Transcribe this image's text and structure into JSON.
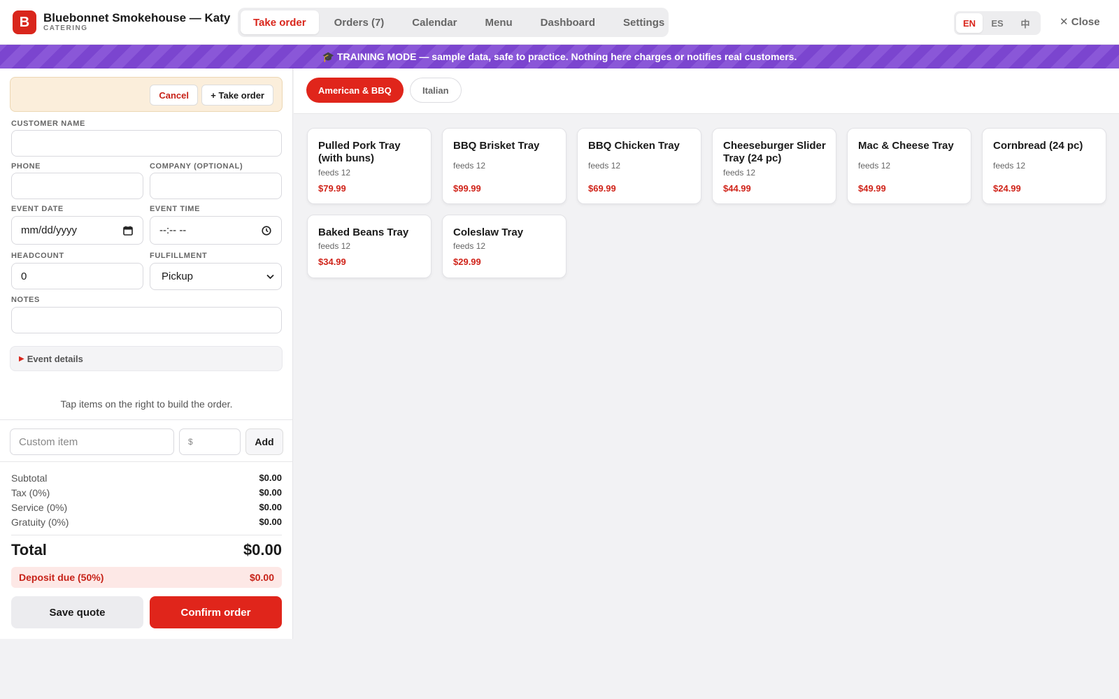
{
  "header": {
    "logo_letter": "B",
    "brand_name": "Bluebonnet Smokehouse — Katy",
    "brand_sub": "CATERING",
    "tabs": [
      {
        "label": "Take order"
      },
      {
        "label": "Orders (7)"
      },
      {
        "label": "Calendar"
      },
      {
        "label": "Menu"
      },
      {
        "label": "Dashboard"
      },
      {
        "label": "Settings"
      }
    ],
    "active_tab": "Take order",
    "languages": [
      "EN",
      "ES",
      "中"
    ],
    "active_language": "EN",
    "close_label": "✕ Close"
  },
  "banner": {
    "text": "🎓 TRAINING MODE — sample data, safe to practice. Nothing here charges or notifies real customers."
  },
  "order_form": {
    "cancel_label": "Cancel",
    "take_order_label": "+ Take order",
    "fields": {
      "customer_name": {
        "label": "CUSTOMER NAME",
        "value": ""
      },
      "phone": {
        "label": "PHONE",
        "value": ""
      },
      "company": {
        "label": "COMPANY (OPTIONAL)",
        "value": ""
      },
      "event_date": {
        "label": "EVENT DATE",
        "placeholder": "mm/dd/yyyy"
      },
      "event_time": {
        "label": "EVENT TIME",
        "placeholder": "--:-- --"
      },
      "headcount": {
        "label": "HEADCOUNT",
        "value": "0"
      },
      "fulfillment": {
        "label": "FULFILLMENT",
        "value": "Pickup"
      },
      "notes": {
        "label": "NOTES",
        "value": ""
      }
    },
    "event_details_label": "Event details",
    "hint": "Tap items on the right to build the order.",
    "custom_item": {
      "placeholder": "Custom item",
      "price_placeholder": "$",
      "add_label": "Add"
    }
  },
  "summary": {
    "rows": [
      {
        "label": "Subtotal",
        "value": "$0.00"
      },
      {
        "label": "Tax (0%)",
        "value": "$0.00"
      },
      {
        "label": "Service (0%)",
        "value": "$0.00"
      },
      {
        "label": "Gratuity (0%)",
        "value": "$0.00"
      }
    ],
    "total_label": "Total",
    "total_value": "$0.00",
    "deposit_label": "Deposit due (50%)",
    "deposit_value": "$0.00",
    "save_label": "Save quote",
    "confirm_label": "Confirm order"
  },
  "categories": [
    {
      "label": "American & BBQ",
      "active": true
    },
    {
      "label": "Italian",
      "active": false
    }
  ],
  "menu_items": [
    {
      "name": "Pulled Pork Tray (with buns)",
      "feeds": "feeds 12",
      "price": "$79.99"
    },
    {
      "name": "BBQ Brisket Tray",
      "feeds": "feeds 12",
      "price": "$99.99"
    },
    {
      "name": "BBQ Chicken Tray",
      "feeds": "feeds 12",
      "price": "$69.99"
    },
    {
      "name": "Cheeseburger Slider Tray (24 pc)",
      "feeds": "feeds 12",
      "price": "$44.99"
    },
    {
      "name": "Mac & Cheese Tray",
      "feeds": "feeds 12",
      "price": "$49.99"
    },
    {
      "name": "Cornbread (24 pc)",
      "feeds": "feeds 12",
      "price": "$24.99"
    },
    {
      "name": "Baked Beans Tray",
      "feeds": "feeds 12",
      "price": "$34.99"
    },
    {
      "name": "Coleslaw Tray",
      "feeds": "feeds 12",
      "price": "$29.99"
    }
  ],
  "colors": {
    "accent": "#e0251b",
    "banner": "#8a57d8"
  }
}
